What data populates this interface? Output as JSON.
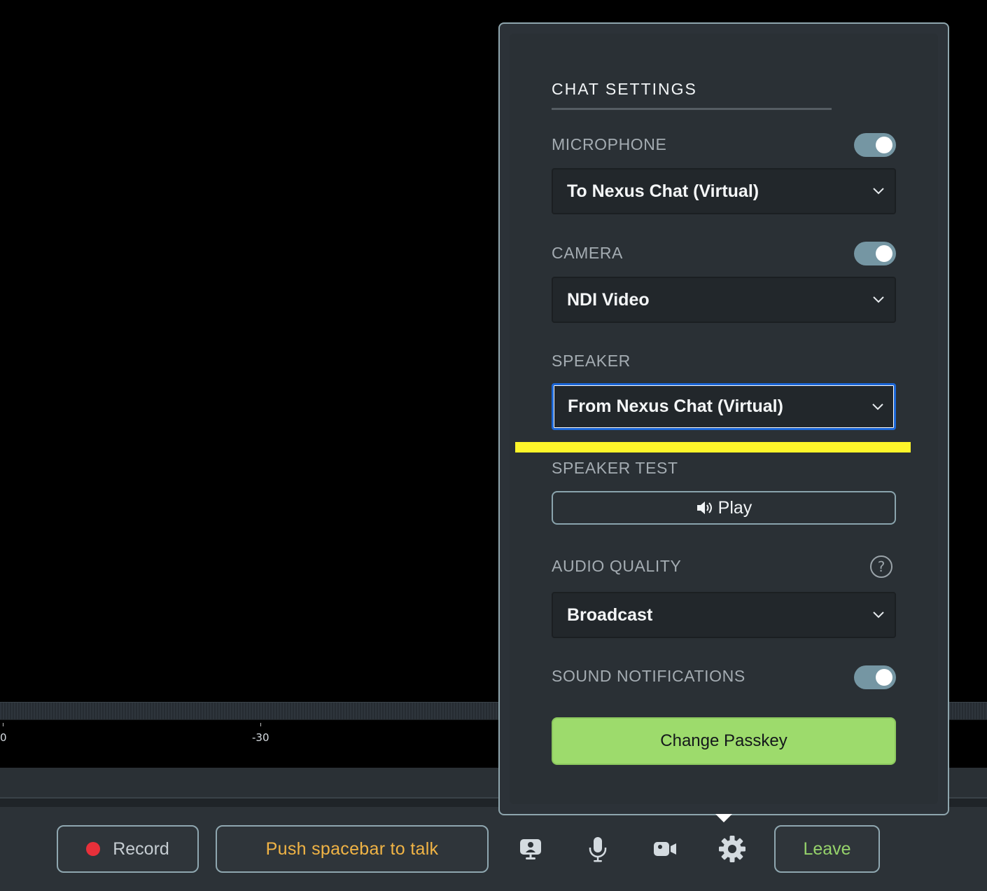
{
  "meter": {
    "labels": [
      "0",
      "-30"
    ]
  },
  "settings": {
    "title": "CHAT SETTINGS",
    "microphone": {
      "label": "MICROPHONE",
      "enabled": true,
      "selected": "To Nexus Chat (Virtual)"
    },
    "camera": {
      "label": "CAMERA",
      "enabled": true,
      "selected": "NDI Video"
    },
    "speaker": {
      "label": "SPEAKER",
      "selected": "From Nexus Chat (Virtual)"
    },
    "speaker_test": {
      "label": "SPEAKER TEST",
      "button_label": "Play"
    },
    "audio_quality": {
      "label": "AUDIO QUALITY",
      "selected": "Broadcast"
    },
    "sound_notifications": {
      "label": "SOUND NOTIFICATIONS",
      "enabled": true
    },
    "change_passkey_label": "Change Passkey"
  },
  "toolbar": {
    "record_label": "Record",
    "push_to_talk_label": "Push spacebar to talk",
    "leave_label": "Leave",
    "icons": [
      "presenter-icon",
      "microphone-icon",
      "camera-icon",
      "gear-icon"
    ]
  },
  "colors": {
    "accent_green": "#9ddb6c",
    "toggle_on": "#7596a3",
    "push_to_talk_text": "#f1b445",
    "record_dot": "#e8303a",
    "focus_ring": "#1b66d6",
    "highlight": "#fef52a"
  }
}
